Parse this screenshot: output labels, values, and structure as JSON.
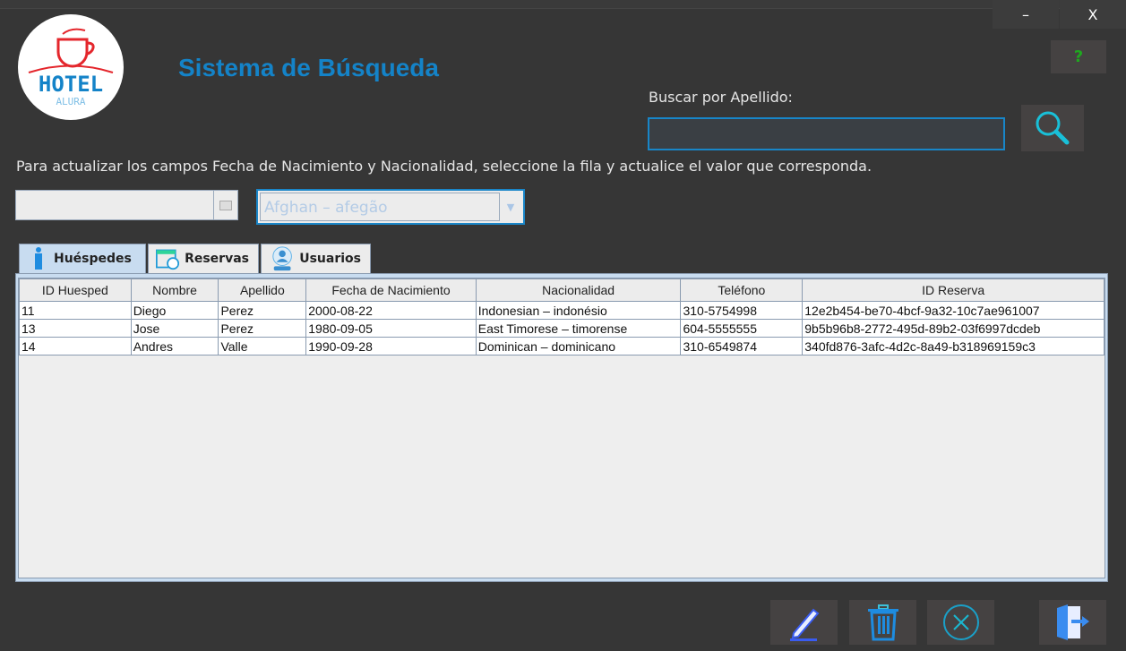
{
  "window": {
    "minimize": "–",
    "close": "X"
  },
  "logo": {
    "text": "HOTEL",
    "subtext": "ALURA"
  },
  "header": {
    "title": "Sistema de Búsqueda",
    "help": "?"
  },
  "search": {
    "label": "Buscar por Apellido:",
    "value": "",
    "placeholder": ""
  },
  "instructions": "Para actualizar los campos Fecha de Nacimiento y Nacionalidad, seleccione la fila y actualice el valor que corresponda.",
  "date_field": {
    "value": ""
  },
  "nationality": {
    "selected": "Afghan – afegão"
  },
  "tabs": [
    {
      "label": "Huéspedes",
      "icon": "person-icon",
      "active": true
    },
    {
      "label": "Reservas",
      "icon": "calendar-clock-icon"
    },
    {
      "label": "Usuarios",
      "icon": "user-icon"
    }
  ],
  "table": {
    "columns": [
      "ID Huesped",
      "Nombre",
      "Apellido",
      "Fecha de Nacimiento",
      "Nacionalidad",
      "Teléfono",
      "ID Reserva"
    ],
    "rows": [
      [
        "11",
        "Diego",
        "Perez",
        "2000-08-22",
        "Indonesian – indonésio",
        "310-5754998",
        "12e2b454-be70-4bcf-9a32-10c7ae961007"
      ],
      [
        "13",
        "Jose",
        "Perez",
        "1980-09-05",
        "East Timorese – timorense",
        "604-5555555",
        "9b5b96b8-2772-495d-89b2-03f6997dcdeb"
      ],
      [
        "14",
        "Andres",
        "Valle",
        "1990-09-28",
        "Dominican – dominicano",
        "310-6549874",
        "340fd876-3afc-4d2c-8a49-b318969159c3"
      ]
    ]
  },
  "actions": [
    {
      "name": "edit",
      "icon": "pencil-icon"
    },
    {
      "name": "delete",
      "icon": "trash-icon"
    },
    {
      "name": "cancel",
      "icon": "cancel-circle-icon"
    },
    {
      "name": "exit",
      "icon": "exit-door-icon"
    }
  ],
  "colors": {
    "accent": "#1483c8",
    "background": "#363636"
  }
}
